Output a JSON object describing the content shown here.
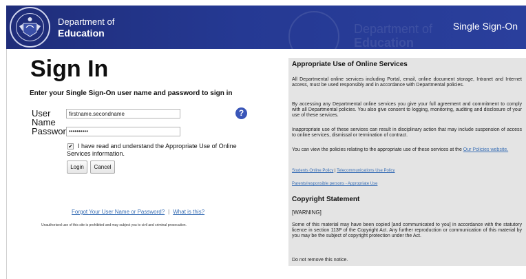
{
  "header": {
    "crest_text": "THE GOVERNMENT OF WESTERN AUSTRALIA",
    "dept_line1": "Department of",
    "dept_line2": "Education",
    "watermark_line1": "Department of",
    "watermark_line2": "Education",
    "sso_label": "Single Sign-On",
    "color": "#253993"
  },
  "signin": {
    "title": "Sign In",
    "instructions": "Enter your Single Sign-On user name and password to sign in",
    "username_label_line1": "User",
    "username_label_line2": "Name",
    "username_value": "firstname.secondname",
    "password_label": "Password",
    "password_value": "••••••••••",
    "help_icon": "question-icon",
    "help_glyph": "?",
    "checkbox_checked": true,
    "checkbox_glyph": "✔",
    "checkbox_label": "I have read and understand the Appropriate Use of Online Services information.",
    "login_label": "Login",
    "cancel_label": "Cancel",
    "forgot_link": "Forgot Your User Name or Password?",
    "separator": "|",
    "what_link": "What is this?",
    "legal": "Unauthorised use of this site is prohibited and may subject you to civil and criminal prosecution."
  },
  "info": {
    "heading": "Appropriate Use of Online Services",
    "p1": "All Departmental online services including Portal, email, online document storage, Intranet and Internet access, must be used responsibly and in accordance with Departmental policies.",
    "p2": "By accessing any Departmental online services you give your full agreement and commitment to comply with all Departmental policies. You also give consent to logging, monitoring, auditing and disclosure of your use of these services.",
    "p3": "Inappropriate use of these services can result in disciplinary action that may include suspension of access to online services, dismissal or termination of contract.",
    "p4": "You can view the policies relating to the appropriate use of these services at the",
    "p4_link": "Our Policies website.",
    "link_students": "Students Online Policy",
    "link_sep": "|",
    "link_telecom": "Telecommunications Use Policy",
    "link_parents": "Parents/responsible persons - Appropriate Use",
    "copyright_heading": "Copyright Statement",
    "warning": "[WARNING]",
    "copyright_text": "Some of this material may have been copied [and communicated to you] in accordance with the statutory licence in section 113P of the Copyright Act. Any further reproduction or communication of this material by you may be the subject of copyright protection under the Act.",
    "do_not_remove": "Do not remove this notice."
  }
}
